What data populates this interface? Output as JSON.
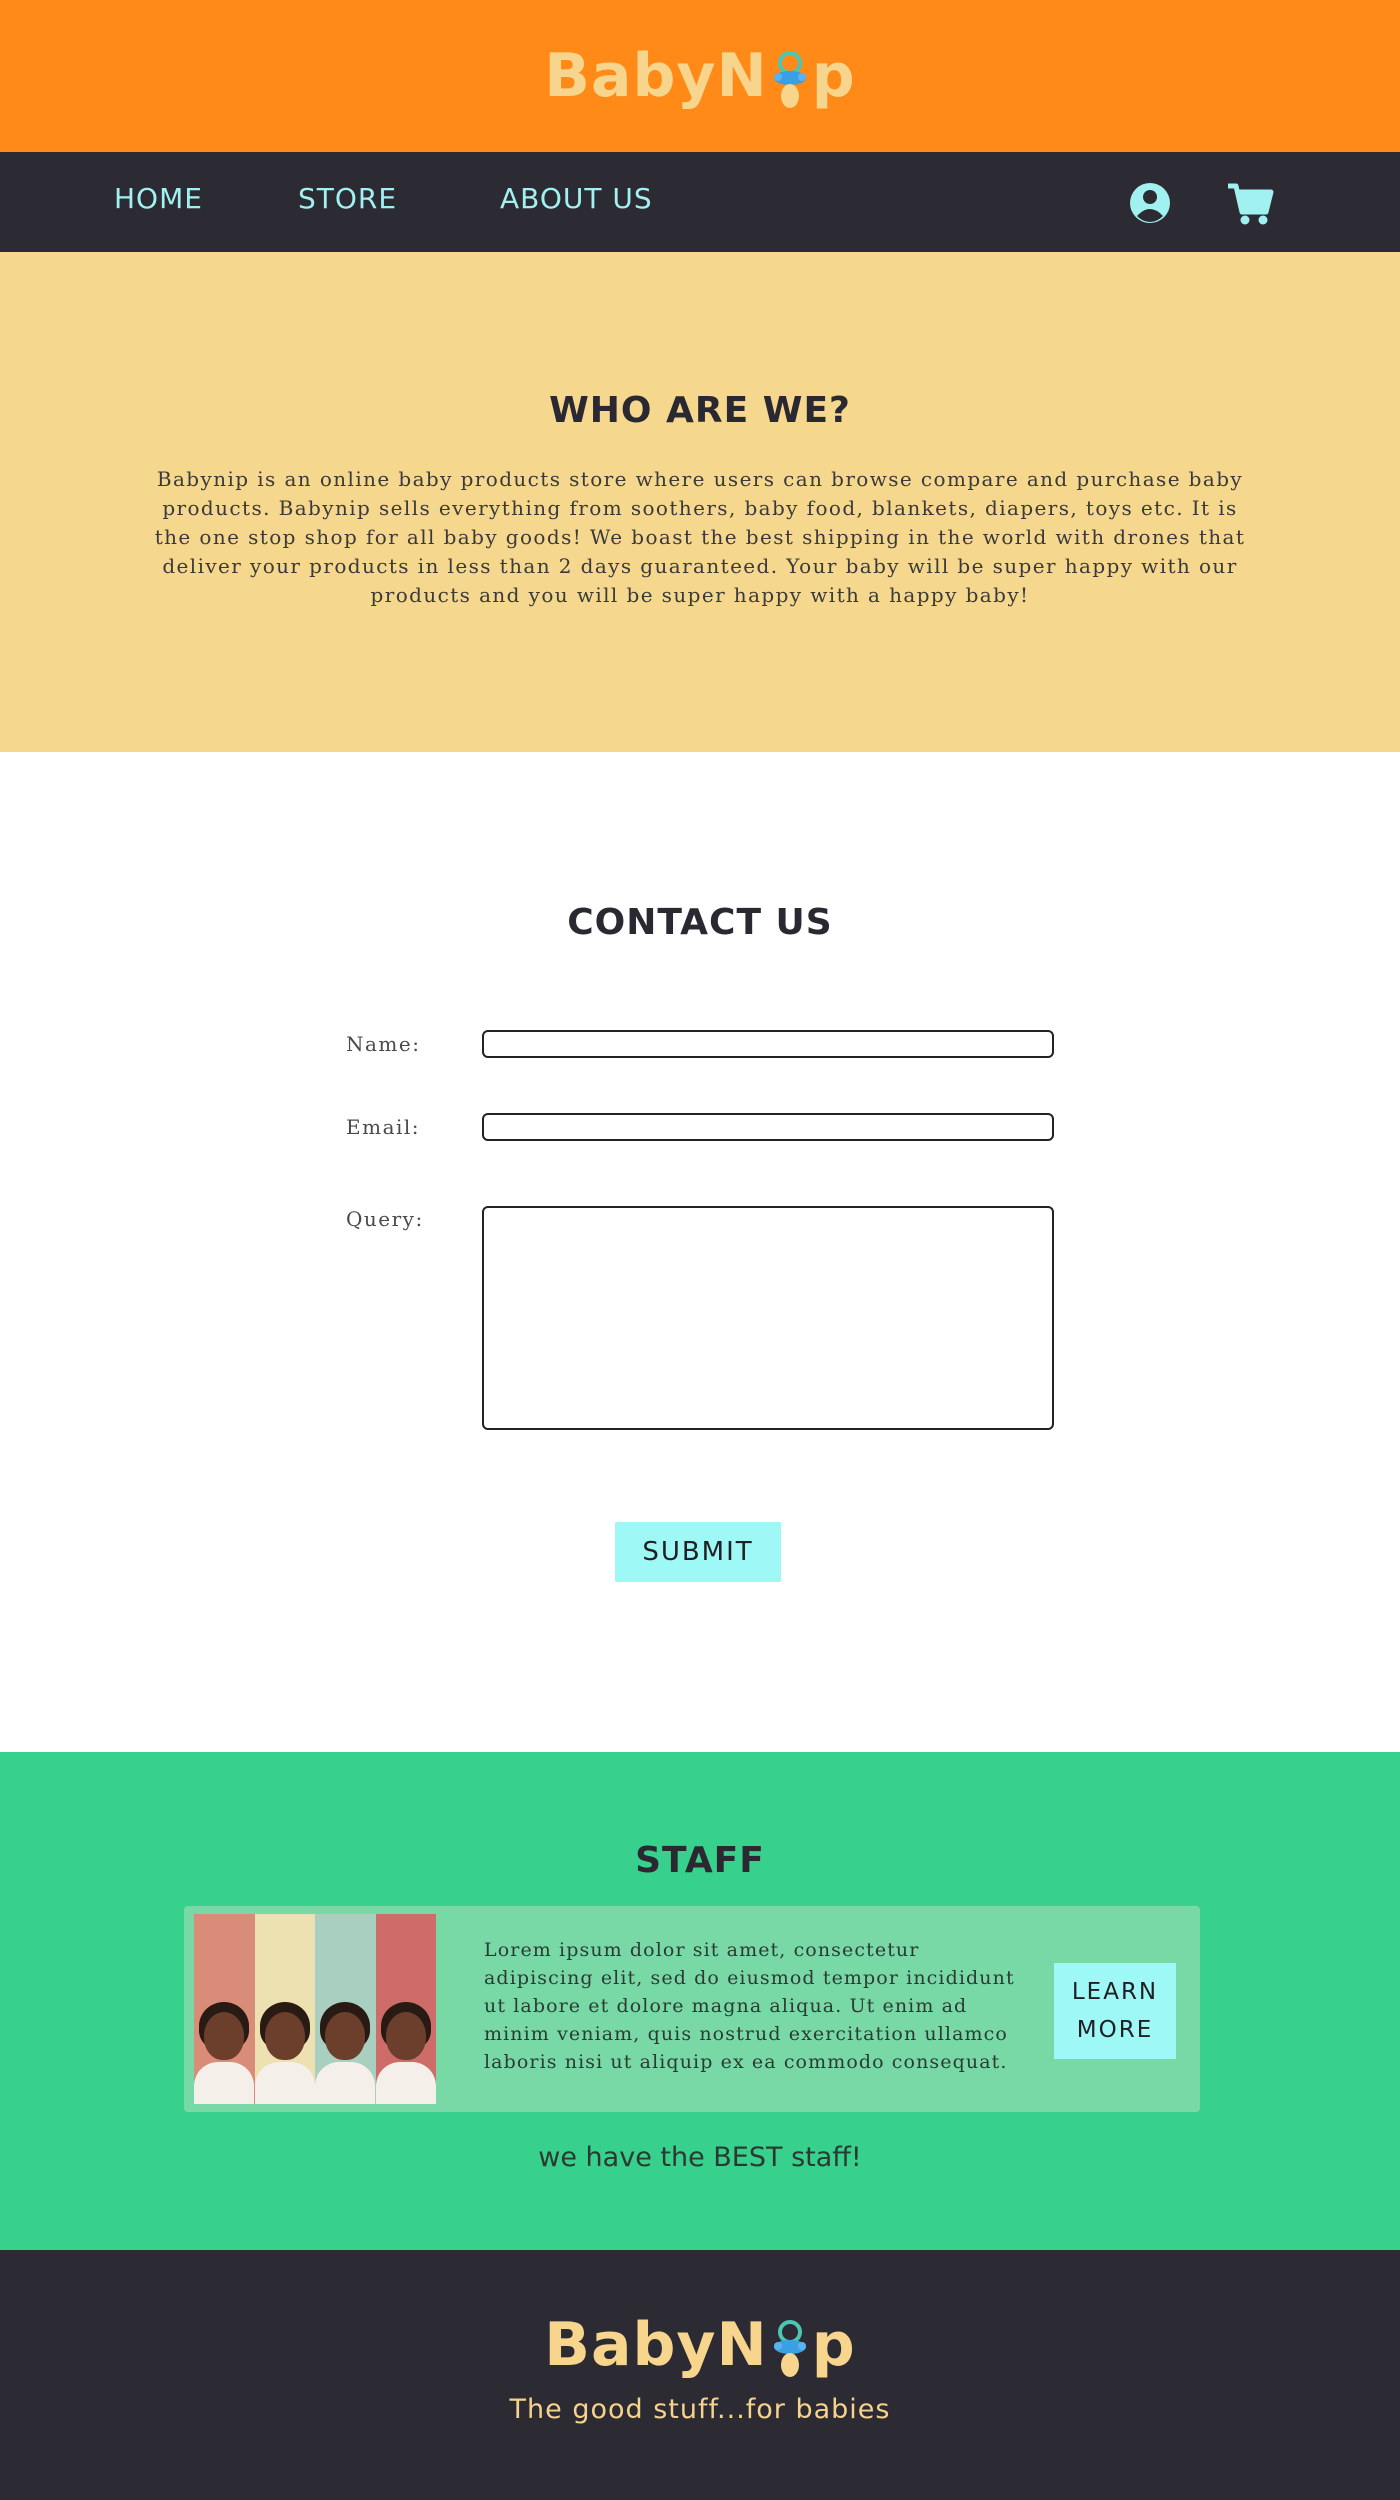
{
  "brand": {
    "logo_left": "BabyN",
    "logo_right": "p",
    "accent_color": "#ff8a18",
    "nav_bg": "#2c2a32",
    "link_color": "#a2f1f1"
  },
  "nav": {
    "links": [
      "HOME",
      "STORE",
      "ABOUT US"
    ],
    "icons": [
      "user-circle-icon",
      "shopping-cart-icon"
    ]
  },
  "about": {
    "title": "WHO ARE WE?",
    "text": "Babynip is an online baby products store where users can browse compare and purchase baby products. Babynip sells everything from soothers, baby food, blankets, diapers, toys etc. It is the one stop shop for all baby goods! We boast the best shipping in the world with drones that deliver your products in less than 2 days guaranteed. Your baby will be super happy with our products and you will be super happy with a happy baby!"
  },
  "contact": {
    "title": "CONTACT US",
    "name_label": "Name:",
    "email_label": "Email:",
    "query_label": "Query:",
    "name_value": "",
    "email_value": "",
    "query_value": "",
    "submit_label": "SUBMIT"
  },
  "staff": {
    "title": "STAFF",
    "description": "Lorem ipsum dolor sit amet, consectetur adipiscing elit, sed do eiusmod tempor incididunt ut labore et dolore magna aliqua. Ut enim ad minim veniam, quis nostrud exercitation ullamco laboris nisi ut aliquip ex ea commodo consequat.",
    "button_line1": "LEARN",
    "button_line2": "MORE",
    "tagline": "we have the BEST staff!",
    "photo_strip_colors": [
      "#d98c78",
      "#ede0b1",
      "#a9cfc0",
      "#ce6c6a"
    ]
  },
  "footer": {
    "tagline": "The good stuff...for babies"
  }
}
